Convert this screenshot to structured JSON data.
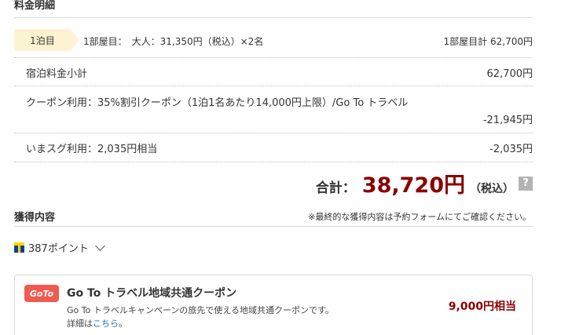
{
  "section": {
    "title": "料金明細"
  },
  "night": {
    "badge": "1泊目",
    "description": "1部屋目：　大人：31,350円（税込）×2名",
    "room_total": "1部屋目計 62,700円"
  },
  "rows": [
    {
      "label": "宿泊料金小計",
      "value": "62,700円"
    },
    {
      "label": "クーポン利用：35%割引クーポン（1泊1名あたり14,000円上限）/Go To トラベル",
      "value": "-21,945円"
    },
    {
      "label": "いまスグ利用：2,035円相当",
      "value": "-2,035円"
    }
  ],
  "total": {
    "label": "合計：",
    "amount": "38,720円",
    "tax": "（税込）",
    "help": "?"
  },
  "earn": {
    "title": "獲得内容",
    "note": "※最終的な獲得内容は予約フォームにてご確認ください。",
    "points": "387ポイント"
  },
  "coupon": {
    "logo": "GoTo",
    "title": "Go To トラベル地域共通クーポン",
    "description": "Go To トラベルキャンペーンの旅先で使える地域共通クーポンです。",
    "detail_prefix": "詳細は",
    "detail_link": "こちら",
    "detail_suffix": "。",
    "amount": "9,000円相当"
  },
  "colors": {
    "accent_price": "#8b0000",
    "badge_bg": "#fdf3d1",
    "goto_red": "#f05a50",
    "link": "#1a6bc4"
  },
  "icons": {
    "points": "t-point-icon",
    "expand": "chevron-down-icon",
    "help": "help-icon"
  }
}
